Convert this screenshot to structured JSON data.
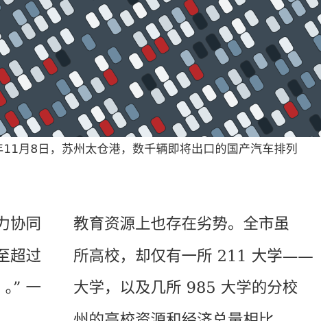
{
  "photo": {
    "subject": "car-park-photo"
  },
  "caption": "年11月8日，苏州太仓港，数千辆即将出口的国产汽车排列",
  "left_column": [
    "力协同",
    "至超过",
    "。” 一"
  ],
  "right_column": [
    "教育资源上也存在劣势。全市虽",
    "所高校，却仅有一所 211 大学——",
    "大学，以及几所 985 大学的分校",
    "州的高校资源和经济总量相比，"
  ]
}
